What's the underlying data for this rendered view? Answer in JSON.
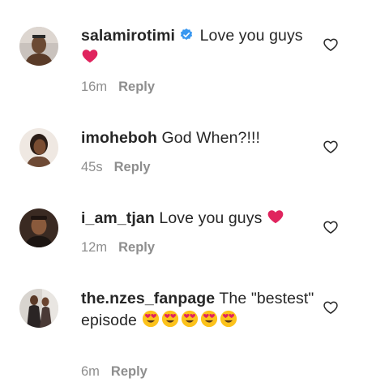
{
  "comments": [
    {
      "username": "salamirotimi",
      "verified": true,
      "text": "Love you guys",
      "emojis": [
        "red-heart"
      ],
      "time": "16m",
      "reply_label": "Reply"
    },
    {
      "username": "imoheboh",
      "verified": false,
      "text": "God When?!!!",
      "emojis": [],
      "time": "45s",
      "reply_label": "Reply"
    },
    {
      "username": "i_am_tjan",
      "verified": false,
      "text": "Love you guys",
      "emojis": [
        "red-heart"
      ],
      "time": "12m",
      "reply_label": "Reply"
    },
    {
      "username": "the.nzes_fanpage",
      "verified": false,
      "text": "The \"bestest\" episode",
      "emojis": [
        "heart-eyes",
        "heart-eyes",
        "heart-eyes",
        "heart-eyes",
        "heart-eyes"
      ],
      "time": "6m",
      "reply_label": "Reply"
    }
  ],
  "colors": {
    "verified_badge": "#3897f0",
    "muted_text": "#8e8e8e",
    "heart_emoji": "#e0245e"
  },
  "icons": {
    "like": "heart-outline-icon",
    "verified": "verified-badge-icon"
  }
}
